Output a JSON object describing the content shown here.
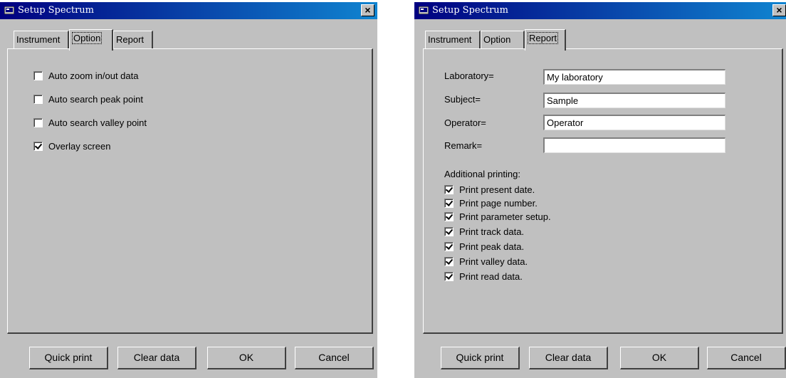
{
  "left": {
    "title": "Setup Spectrum",
    "tabs": [
      "Instrument",
      "Option",
      "Report"
    ],
    "active_tab": "Option",
    "options": [
      {
        "label": "Auto zoom in/out data",
        "checked": false
      },
      {
        "label": "Auto search peak point",
        "checked": false
      },
      {
        "label": "Auto search valley point",
        "checked": false
      },
      {
        "label": "Overlay screen",
        "checked": true
      }
    ],
    "buttons": [
      "Quick print",
      "Clear data",
      "OK",
      "Cancel"
    ]
  },
  "right": {
    "title": "Setup Spectrum",
    "tabs": [
      "Instrument",
      "Option",
      "Report"
    ],
    "active_tab": "Report",
    "fields": [
      {
        "label": "Laboratory=",
        "value": "My laboratory"
      },
      {
        "label": "Subject=",
        "value": "Sample"
      },
      {
        "label": "Operator=",
        "value": "Operator"
      },
      {
        "label": "Remark=",
        "value": ""
      }
    ],
    "additional_heading": "Additional printing:",
    "print_options": [
      {
        "label": "Print present date.",
        "checked": true
      },
      {
        "label": "Print page number.",
        "checked": true
      },
      {
        "label": "Print parameter setup.",
        "checked": true
      },
      {
        "label": "Print track data.",
        "checked": true
      },
      {
        "label": "Print peak data.",
        "checked": true
      },
      {
        "label": "Print valley data.",
        "checked": true
      },
      {
        "label": "Print read data.",
        "checked": true
      }
    ],
    "buttons": [
      "Quick print",
      "Clear data",
      "OK",
      "Cancel"
    ]
  },
  "close_glyph": "×",
  "colors": {
    "titlebar_start": "#000080",
    "titlebar_end": "#1084d0",
    "face": "#c0c0c0"
  }
}
